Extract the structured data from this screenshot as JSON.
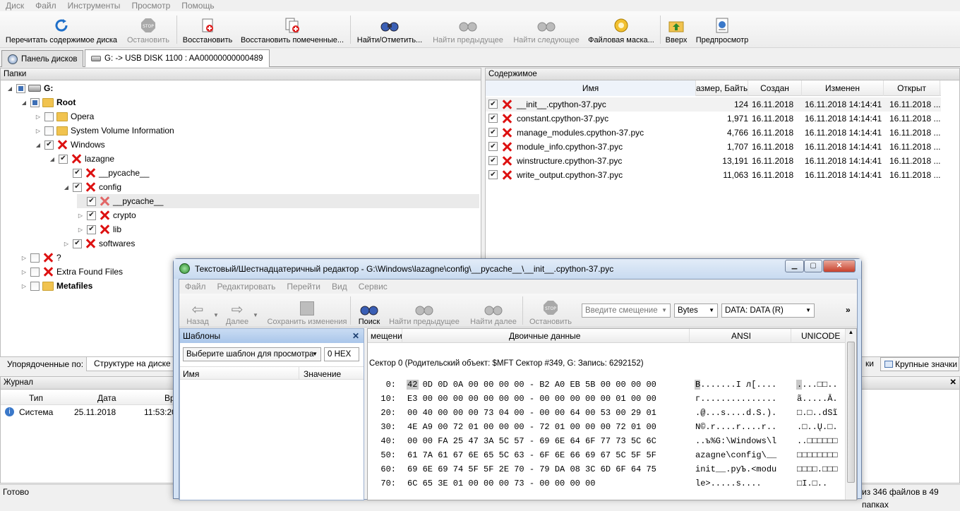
{
  "menu": [
    "Диск",
    "Файл",
    "Инструменты",
    "Просмотр",
    "Помощь"
  ],
  "toolbar": {
    "rescan": "Перечитать содержимое диска",
    "stop": "Остановить",
    "restore": "Восстановить",
    "restore_marked": "Восстановить помеченные...",
    "find": "Найти/Отметить...",
    "find_prev": "Найти предыдущее",
    "find_next": "Найти следующее",
    "mask": "Файловая маска...",
    "up": "Вверх",
    "preview": "Предпросмотр"
  },
  "tabs": {
    "drives": "Панель дисков",
    "current": "G: -> USB DISK 1100 : AA00000000000489"
  },
  "folders": {
    "header": "Папки",
    "items": {
      "g": "G:",
      "root": "Root",
      "opera": "Opera",
      "svi": "System Volume Information",
      "windows": "Windows",
      "lazagne": "lazagne",
      "pycache1": "__pycache__",
      "config": "config",
      "pycache2": "__pycache__",
      "crypto": "crypto",
      "lib": "lib",
      "softwares": "softwares",
      "q": "?",
      "extra": "Extra Found Files",
      "meta": "Metafiles"
    }
  },
  "contents": {
    "header": "Содержимое",
    "columns": {
      "name": "Имя",
      "size": "азмер, Байты",
      "created": "Создан",
      "modified": "Изменен",
      "opened": "Открыт"
    },
    "files": [
      {
        "name": "__init__.cpython-37.pyc",
        "size": "124",
        "created": "16.11.2018",
        "modified": "16.11.2018 14:14:41",
        "opened": "16.11.2018 ..."
      },
      {
        "name": "constant.cpython-37.pyc",
        "size": "1,971",
        "created": "16.11.2018",
        "modified": "16.11.2018 14:14:41",
        "opened": "16.11.2018 ..."
      },
      {
        "name": "manage_modules.cpython-37.pyc",
        "size": "4,766",
        "created": "16.11.2018",
        "modified": "16.11.2018 14:14:41",
        "opened": "16.11.2018 ..."
      },
      {
        "name": "module_info.cpython-37.pyc",
        "size": "1,707",
        "created": "16.11.2018",
        "modified": "16.11.2018 14:14:41",
        "opened": "16.11.2018 ..."
      },
      {
        "name": "winstructure.cpython-37.pyc",
        "size": "13,191",
        "created": "16.11.2018",
        "modified": "16.11.2018 14:14:41",
        "opened": "16.11.2018 ..."
      },
      {
        "name": "write_output.cpython-37.pyc",
        "size": "11,063",
        "created": "16.11.2018",
        "modified": "16.11.2018 14:14:41",
        "opened": "16.11.2018 ..."
      }
    ]
  },
  "sortbar": {
    "label": "Упорядоченные по:",
    "tab": "Структуре на диске",
    "right1": "ки",
    "right2": "Крупные значки"
  },
  "journal": {
    "title": "Журнал",
    "cols": {
      "type": "Тип",
      "date": "Дата",
      "time": "Вр"
    },
    "row": {
      "type": "Система",
      "date": "25.11.2018",
      "time": "11:53:20"
    }
  },
  "status": {
    "left": "Готово",
    "right": "из 346 файлов в 49 папках"
  },
  "editor": {
    "title": "Текстовый/Шестнадцатеричный редактор - G:\\Windows\\lazagne\\config\\__pycache__\\__init__.cpython-37.pyc",
    "menu": [
      "Файл",
      "Редактировать",
      "Перейти",
      "Вид",
      "Сервис"
    ],
    "tools": {
      "back": "Назад",
      "forward": "Далее",
      "save": "Сохранить изменения",
      "search": "Поиск",
      "prev": "Найти предыдущее",
      "next": "Найти далее",
      "stop": "Остановить"
    },
    "offset_placeholder": "Введите смещение",
    "unit": "Bytes",
    "data": "DATA: DATA (R)",
    "templates": {
      "title": "Шаблоны",
      "select": "Выберите шаблон для просмотра",
      "hex": "0 HEX",
      "col_name": "Имя",
      "col_value": "Значение"
    },
    "hexview": {
      "cols": {
        "offset": "мещени",
        "binary": "Двоичные данные",
        "ansi": "ANSI",
        "unicode": "UNICODE"
      },
      "sector": "Сектор 0 (Родительский объект: $MFT Сектор #349, G: Запись: 6292152)",
      "lines": [
        {
          "off": "0:",
          "hex": "42 0D 0D 0A 00 00 00 00 - B2 A0 EB 5B 00 00 00 00",
          "ansi": "B.......І л[....",
          "uni": "....□□.."
        },
        {
          "off": "10:",
          "hex": "E3 00 00 00 00 00 00 00 - 00 00 00 00 00 01 00 00",
          "ansi": "г...............",
          "uni": "ã.....Ā."
        },
        {
          "off": "20:",
          "hex": "00 40 00 00 00 73 04 00 - 00 00 64 00 53 00 29 01",
          "ansi": ".@...s....d.S.).",
          "uni": "□.□..dSĩ"
        },
        {
          "off": "30:",
          "hex": "4E A9 00 72 01 00 00 00 - 72 01 00 00 00 72 01 00",
          "ansi": "N©.r....r....r..",
          "uni": ".□..Ų.□."
        },
        {
          "off": "40:",
          "hex": "00 00 FA 25 47 3A 5C 57 - 69 6E 64 6F 77 73 5C 6C",
          "ansi": "..ъ%G:\\Windows\\l",
          "uni": "..□□□□□□"
        },
        {
          "off": "50:",
          "hex": "61 7A 61 67 6E 65 5C 63 - 6F 6E 66 69 67 5C 5F 5F",
          "ansi": "azagne\\config\\__",
          "uni": "□□□□□□□□"
        },
        {
          "off": "60:",
          "hex": "69 6E 69 74 5F 5F 2E 70 - 79 DA 08 3C 6D 6F 64 75",
          "ansi": "init__.pyЪ.<modu",
          "uni": "□□□□.□□□"
        },
        {
          "off": "70:",
          "hex": "6C 65 3E 01 00 00 00 73 - 00 00 00 00",
          "ansi": "le>.....s....",
          "uni": "□I.□.."
        }
      ]
    }
  }
}
